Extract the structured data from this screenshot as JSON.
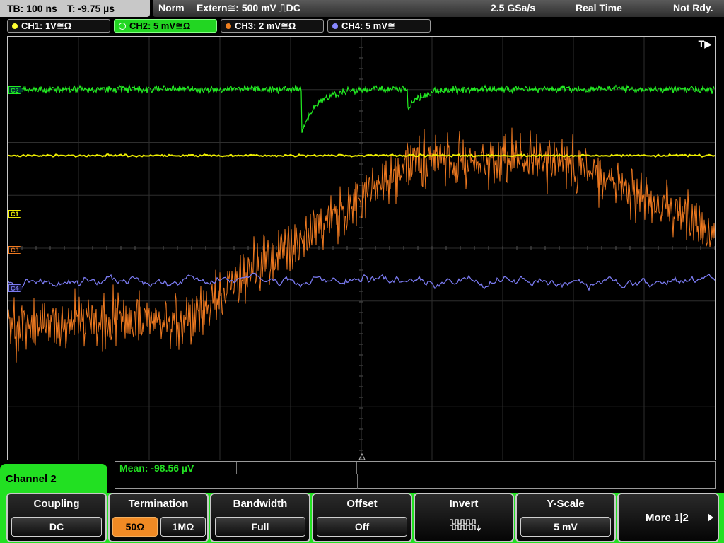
{
  "status": {
    "timebase": "TB: 100 ns",
    "trigger_time": "T: -9.75 µs",
    "mode": "Norm",
    "trigger_source": "Extern≅: 500 mV ⎍DC",
    "sample_rate": "2.5 GSa/s",
    "acquisition": "Real Time",
    "state": "Not Rdy."
  },
  "channel_tabs": [
    {
      "label": "CH1: 1V≅Ω",
      "color": "#ffff33",
      "active": false
    },
    {
      "label": "CH2: 5 mV≅Ω",
      "color": "#22dd22",
      "active": true
    },
    {
      "label": "CH3: 2 mV≅Ω",
      "color": "#f08020",
      "active": false
    },
    {
      "label": "CH4: 5 mV≅",
      "color": "#8888ff",
      "active": false
    }
  ],
  "screen": {
    "trigger_marker": "T▶",
    "channel_markers": [
      "C2",
      "C1",
      "C3",
      "C4"
    ],
    "trace_colors": {
      "ch1": "#f0f000",
      "ch2": "#22ee22",
      "ch3": "#f07a20",
      "ch4": "#7a7af0"
    }
  },
  "measurement": {
    "text": "Mean: -98.56 µV"
  },
  "menu": {
    "title": "Channel 2",
    "coupling": {
      "label": "Coupling",
      "value": "DC"
    },
    "termination": {
      "label": "Termination",
      "options": [
        "50Ω",
        "1MΩ"
      ],
      "selected": "50Ω"
    },
    "bandwidth": {
      "label": "Bandwidth",
      "value": "Full"
    },
    "offset": {
      "label": "Offset",
      "value": "Off"
    },
    "invert": {
      "label": "Invert",
      "icon": "invert-waveform-icon"
    },
    "yscale": {
      "label": "Y-Scale",
      "value": "5 mV"
    },
    "more": {
      "label": "More 1|2",
      "icon": "right-arrow-icon"
    }
  }
}
